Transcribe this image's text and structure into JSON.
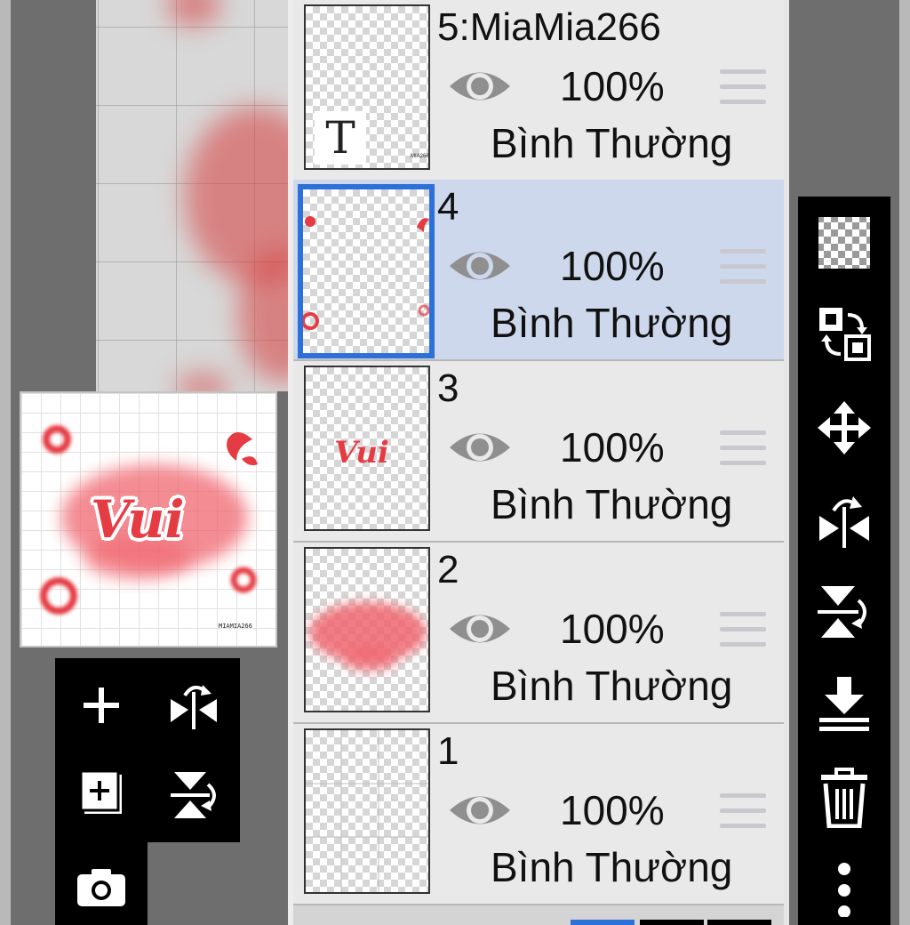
{
  "layers": [
    {
      "name": "5:MiaMia266",
      "opacity": "100%",
      "blend_mode": "Bình Thường",
      "thumb_text": "T",
      "thumb_mark": "MIA266",
      "selected": false
    },
    {
      "name": "4",
      "opacity": "100%",
      "blend_mode": "Bình Thường",
      "selected": true
    },
    {
      "name": "3",
      "opacity": "100%",
      "blend_mode": "Bình Thường",
      "thumb_text": "Vui",
      "selected": false
    },
    {
      "name": "2",
      "opacity": "100%",
      "blend_mode": "Bình Thường",
      "selected": false
    },
    {
      "name": "1",
      "opacity": "100%",
      "blend_mode": "Bình Thường",
      "selected": false
    }
  ],
  "preview": {
    "title_text": "Vui",
    "watermark": "MIAMIA266"
  },
  "left_toolbar": [
    "add-layer-icon",
    "flip-horizontal-icon",
    "add-layer-copy-icon",
    "flip-vertical-icon",
    "camera-icon"
  ],
  "right_toolbar": [
    "transparency-icon",
    "swap-layers-icon",
    "move-icon",
    "flip-horizontal-icon",
    "flip-vertical-icon",
    "merge-down-icon",
    "delete-icon",
    "more-icon"
  ],
  "colors": {
    "selected_bg": "#cdd8ec",
    "selected_border": "#2c70d8",
    "accent_red": "#e53b43"
  }
}
